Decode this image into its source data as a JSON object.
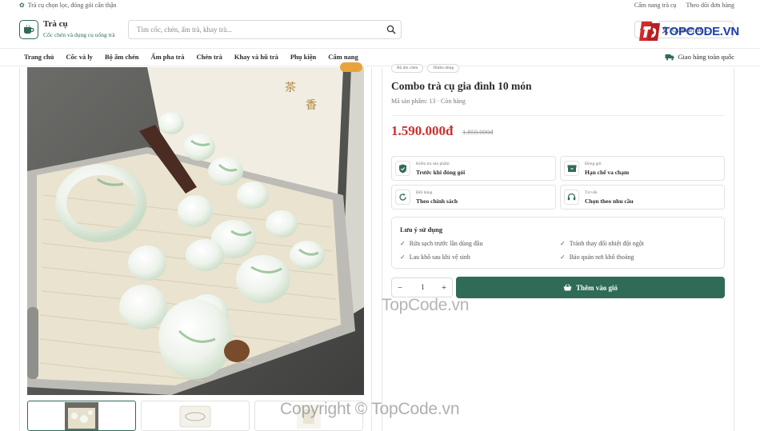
{
  "topbar": {
    "tagline": "Trà cụ chọn lọc, đóng gói cẩn thận",
    "links": [
      "Cẩm nang trà cụ",
      "Theo dõi đơn hàng"
    ]
  },
  "header": {
    "brand_name": "Trà cụ",
    "brand_sub": "Cốc chén và dụng cụ uống trà",
    "search_placeholder": "Tìm cốc, chén, ấm trà, khay trà...",
    "search_value": "",
    "user_label": "Quản trị hệ ...",
    "watermark_logo": "TOPCODE.VN"
  },
  "nav": {
    "items": [
      "Trang chủ",
      "Cốc và ly",
      "Bộ ấm chén",
      "Ấm pha trà",
      "Chén trà",
      "Khay và hũ trà",
      "Phụ kiện",
      "Cẩm nang"
    ],
    "shipping": "Giao hàng toàn quốc"
  },
  "product": {
    "chips": [
      "Bộ ấm chén",
      "Nhiều dòng"
    ],
    "title": "Combo trà cụ gia đình 10 món",
    "meta": "Mã sản phẩm: 13 · Còn hàng",
    "price": "1.590.000đ",
    "old_price": "1.850.000đ",
    "features": [
      {
        "key": "Kiểm tra sản phẩm",
        "value": "Trước khi đóng gói",
        "icon": "shield-check-icon"
      },
      {
        "key": "Đóng gói",
        "value": "Hạn chế va chạm",
        "icon": "box-icon"
      },
      {
        "key": "Đổi hàng",
        "value": "Theo chính sách",
        "icon": "refresh-icon"
      },
      {
        "key": "Tư vấn",
        "value": "Chọn theo nhu cầu",
        "icon": "headset-icon"
      }
    ],
    "usage_title": "Lưu ý sử dụng",
    "usage": [
      "Rửa sạch trước lần dùng đầu",
      "Tránh thay đổi nhiệt đột ngột",
      "Lau khô sau khi vệ sinh",
      "Bảo quản nơi khô thoáng"
    ],
    "quantity": "1",
    "add_to_cart": "Thêm vào giỏ"
  },
  "watermarks": {
    "middle": "TopCode.vn",
    "bottom": "Copyright © TopCode.vn"
  },
  "colors": {
    "accent": "#2f6b57",
    "price": "#c8322e",
    "badge": "#e8a43a"
  }
}
